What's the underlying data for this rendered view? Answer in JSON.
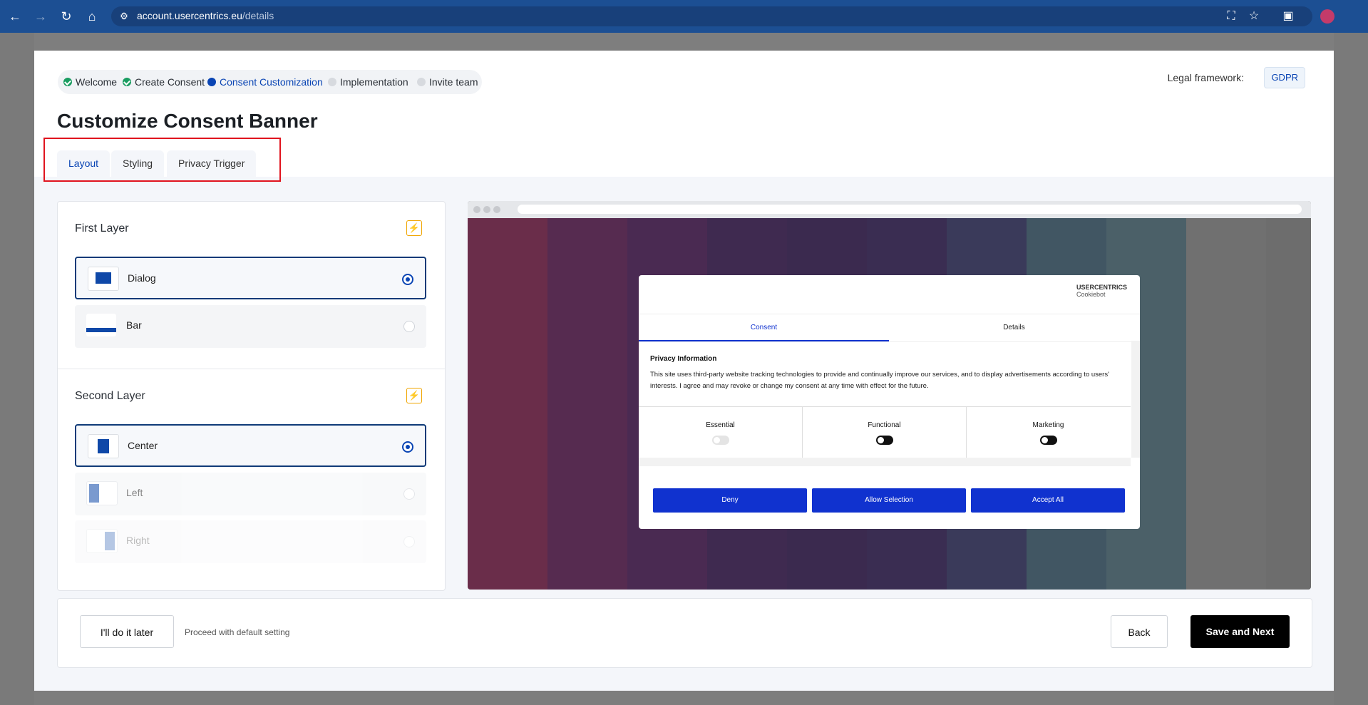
{
  "browser": {
    "url_host": "account.usercentrics.eu",
    "url_path": "/details"
  },
  "stepper": {
    "steps": [
      {
        "label": "Welcome",
        "state": "done"
      },
      {
        "label": "Create Consent",
        "state": "done"
      },
      {
        "label": "Consent Customization",
        "state": "active"
      },
      {
        "label": "Implementation",
        "state": "todo"
      },
      {
        "label": "Invite team",
        "state": "todo"
      }
    ]
  },
  "legal": {
    "label": "Legal framework:",
    "value": "GDPR"
  },
  "page_title": "Customize Consent Banner",
  "tabs": [
    {
      "label": "Layout",
      "active": true
    },
    {
      "label": "Styling",
      "active": false
    },
    {
      "label": "Privacy Trigger",
      "active": false
    }
  ],
  "first_layer": {
    "heading": "First Layer",
    "options": [
      {
        "label": "Dialog",
        "selected": true
      },
      {
        "label": "Bar",
        "selected": false
      }
    ]
  },
  "second_layer": {
    "heading": "Second Layer",
    "options": [
      {
        "label": "Center",
        "selected": true
      },
      {
        "label": "Left",
        "selected": false
      },
      {
        "label": "Right",
        "selected": false
      }
    ]
  },
  "banner": {
    "logo": "USERCENTRICS",
    "logo_sub": "Cookiebot",
    "tabs": [
      "Consent",
      "Details"
    ],
    "info_heading": "Privacy Information",
    "info_text": "This site uses third-party website tracking technologies to provide and continually improve our services, and to display advertisements according to users' interests. I agree and may revoke or change my consent at any time with effect for the future.",
    "categories": [
      "Essential",
      "Functional",
      "Marketing"
    ],
    "buttons": [
      "Deny",
      "Allow Selection",
      "Accept All"
    ]
  },
  "footer": {
    "later_label": "I'll do it later",
    "later_note": "Proceed with default setting",
    "back_label": "Back",
    "save_label": "Save and Next"
  },
  "colors": {
    "accent": "#0a45b4",
    "banner_button": "#1032cf",
    "highlight_box": "#e0141e",
    "stripes": [
      "#6a2d4a",
      "#562b50",
      "#4a2a52",
      "#3f2a50",
      "#3b2a4f",
      "#3a2d52",
      "#3a3a5a",
      "#415663",
      "#4b6068",
      "#707070",
      "#6d6d6d"
    ]
  }
}
